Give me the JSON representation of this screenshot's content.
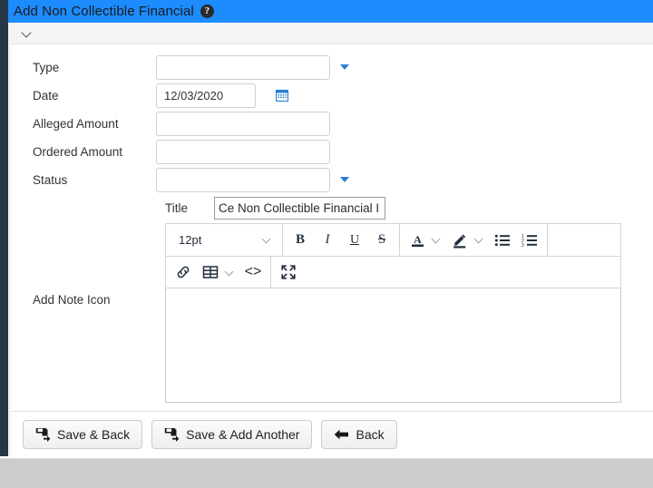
{
  "window": {
    "title": "Add Non Collectible Financial",
    "help_icon": "help-circle-icon",
    "accent_color": "#1c8cff",
    "sidebar_color": "#253746",
    "page_background": "#cccccc"
  },
  "collapse_bar": {
    "icon": "chevron-down-icon"
  },
  "form": {
    "fields": [
      {
        "label": "Type",
        "value": "",
        "placeholder": "",
        "control": "select",
        "has_caret": true
      },
      {
        "label": "Date",
        "value": "12/03/2020",
        "placeholder": "",
        "control": "date",
        "has_caret": false,
        "icon": "calendar-icon"
      },
      {
        "label": "Alleged Amount",
        "value": "",
        "placeholder": "",
        "control": "text",
        "has_caret": false
      },
      {
        "label": "Ordered Amount",
        "value": "",
        "placeholder": "",
        "control": "text",
        "has_caret": false
      },
      {
        "label": "Status",
        "value": "",
        "placeholder": "",
        "control": "select",
        "has_caret": true
      }
    ],
    "title_row": {
      "label": "Title",
      "value": "Ce Non Collectible Financial I"
    },
    "note_row": {
      "label": "Add Note Icon"
    }
  },
  "editor": {
    "font_size": "12pt",
    "toolbar_row1": [
      {
        "name": "bold-icon",
        "glyph": "B"
      },
      {
        "name": "italic-icon",
        "glyph": "I"
      },
      {
        "name": "underline-icon",
        "glyph": "U"
      },
      {
        "name": "strikethrough-icon",
        "glyph": "S"
      },
      {
        "name": "text-color-icon",
        "glyph": "A"
      },
      {
        "name": "highlight-color-icon",
        "glyph": "pen"
      },
      {
        "name": "bullet-list-icon",
        "glyph": "list"
      },
      {
        "name": "numbered-list-icon",
        "glyph": "list-ol"
      }
    ],
    "toolbar_row2": [
      {
        "name": "link-icon",
        "glyph": "link"
      },
      {
        "name": "table-icon",
        "glyph": "table"
      },
      {
        "name": "source-code-icon",
        "glyph": "<>"
      },
      {
        "name": "fullscreen-icon",
        "glyph": "expand"
      }
    ],
    "body_value": ""
  },
  "footer": {
    "buttons": [
      {
        "label": "Save & Back",
        "icon": "save-icon"
      },
      {
        "label": "Save & Add Another",
        "icon": "save-icon"
      },
      {
        "label": "Back",
        "icon": "arrow-left-icon"
      }
    ]
  }
}
